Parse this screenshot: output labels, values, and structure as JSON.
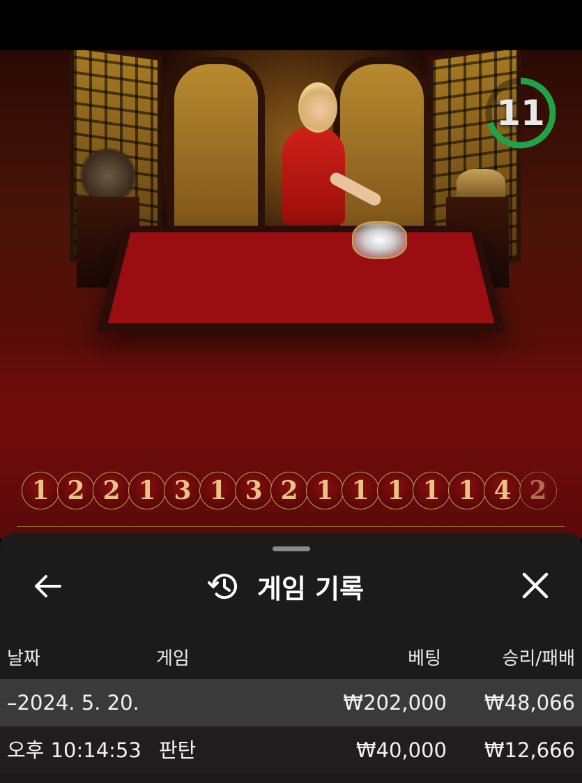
{
  "timer": {
    "value": "11",
    "progress": 0.7,
    "color": "#1fa346"
  },
  "results": [
    "1",
    "2",
    "2",
    "1",
    "3",
    "1",
    "3",
    "2",
    "1",
    "1",
    "1",
    "1",
    "1",
    "4",
    "2"
  ],
  "panel": {
    "title": "게임 기록",
    "icons": {
      "back": "back-arrow-icon",
      "history": "history-icon",
      "close": "close-icon"
    },
    "columns": {
      "date": "날짜",
      "game": "게임",
      "bet": "베팅",
      "win_loss": "승리/패배"
    },
    "rows": [
      {
        "type": "date",
        "date": "–2024. 5. 20.",
        "bet": "₩202,000",
        "win_loss": "₩48,066"
      },
      {
        "type": "game",
        "time": "오후 10:14:53",
        "game": "판탄",
        "bet": "₩40,000",
        "win_loss": "₩12,666"
      }
    ]
  },
  "colors": {
    "accent_green": "#1fa346",
    "gold": "#c8a050",
    "table_red": "#9a0d10"
  }
}
